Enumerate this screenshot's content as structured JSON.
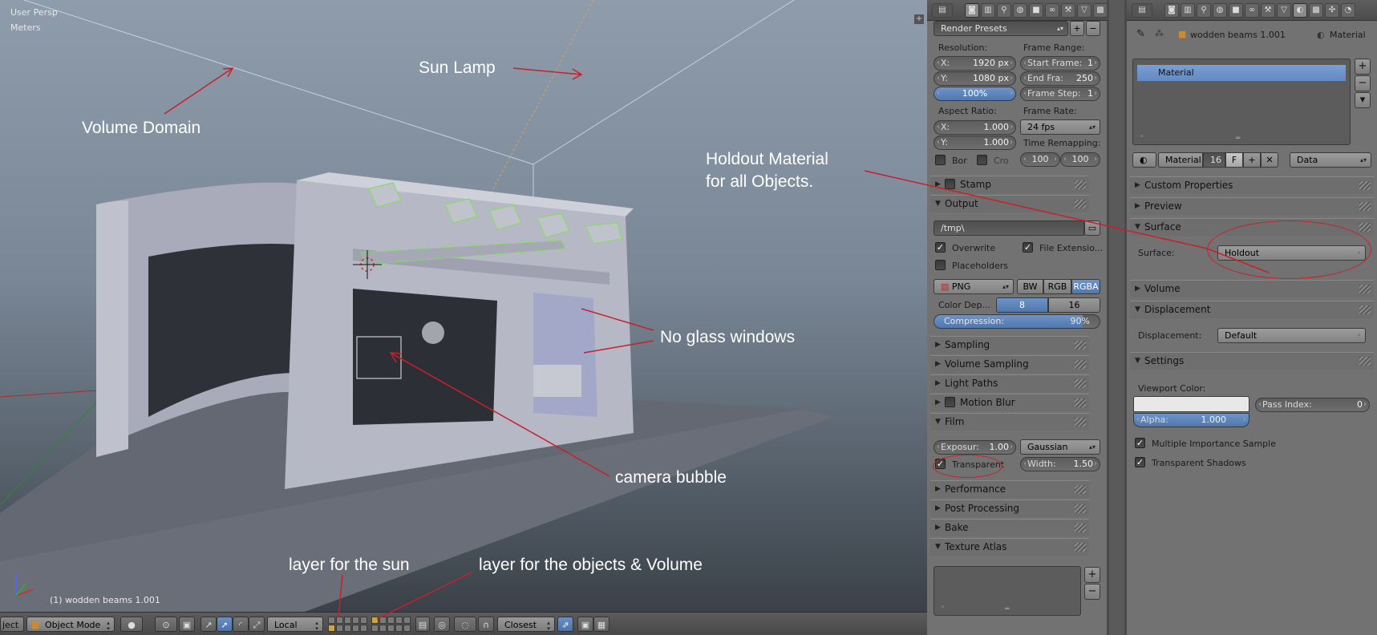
{
  "viewport": {
    "view_name": "User Persp",
    "units": "Meters",
    "object_info": "(1) wodden beams 1.001",
    "annotations": {
      "volume_domain": "Volume Domain",
      "sun_lamp": "Sun Lamp",
      "holdout": "Holdout Material\nfor all Objects.",
      "no_glass": "No glass windows",
      "camera_bubble": "camera bubble",
      "layer_sun": "layer for the sun",
      "layer_objects": "layer for the objects & Volume"
    }
  },
  "header": {
    "menu_cut": "ject",
    "mode": "Object Mode",
    "pivot": "Local",
    "snap": "Closest"
  },
  "render": {
    "presets": "Render Presets",
    "resolution_label": "Resolution:",
    "res_x_key": "X:",
    "res_x": "1920 px",
    "res_y_key": "Y:",
    "res_y": "1080 px",
    "res_pct": "100%",
    "frame_range_label": "Frame Range:",
    "start_key": "Start Frame:",
    "start": "1",
    "end_key": "End Fra:",
    "end": "250",
    "step_key": "Frame Step:",
    "step": "1",
    "aspect_label": "Aspect Ratio:",
    "asp_x_key": "X:",
    "asp_x": "1.000",
    "asp_y_key": "Y:",
    "asp_y": "1.000",
    "frame_rate_label": "Frame Rate:",
    "fps": "24 fps",
    "time_remap_label": "Time Remapping:",
    "remap_old": "100",
    "remap_new": "100",
    "bor": "Bor",
    "cro": "Cro",
    "sections": {
      "stamp": "Stamp",
      "output": "Output",
      "sampling": "Sampling",
      "volume_sampling": "Volume Sampling",
      "light_paths": "Light Paths",
      "motion_blur": "Motion Blur",
      "film": "Film",
      "performance": "Performance",
      "post_processing": "Post Processing",
      "bake": "Bake",
      "texture_atlas": "Texture Atlas"
    },
    "output_path": "/tmp\\",
    "overwrite": "Overwrite",
    "file_ext": "File Extensio...",
    "placeholders": "Placeholders",
    "format": "PNG",
    "bw": "BW",
    "rgb": "RGB",
    "rgba": "RGBA",
    "color_depth_label": "Color Dep...",
    "depth_8": "8",
    "depth_16": "16",
    "compression_key": "Compression:",
    "compression": "90%",
    "compression_value": 0.9,
    "exposure_key": "Exposur:",
    "exposure": "1.00",
    "filter": "Gaussian",
    "transparent": "Transparent",
    "width_key": "Width:",
    "width": "1.50"
  },
  "material": {
    "object_name": "wodden beams 1.001",
    "context": "Material",
    "slot_name": "Material",
    "mat_name": "Material",
    "users": "16",
    "fake": "F",
    "link": "Data",
    "sections": {
      "custom_props": "Custom Properties",
      "preview": "Preview",
      "surface": "Surface",
      "volume": "Volume",
      "displacement": "Displacement",
      "settings": "Settings"
    },
    "surface_label": "Surface:",
    "surface_value": "Holdout",
    "displacement_label": "Displacement:",
    "displacement_value": "Default",
    "viewport_color_label": "Viewport Color:",
    "viewport_color": "#e8e8e8",
    "alpha_key": "Alpha:",
    "alpha": "1.000",
    "pass_index_key": "Pass Index:",
    "pass_index": "0",
    "mis": "Multiple Importance Sample",
    "transparent_shadows": "Transparent Shadows"
  },
  "colors": {
    "annotation_red": "#c8202a",
    "selected_blue": "#5177ad"
  }
}
